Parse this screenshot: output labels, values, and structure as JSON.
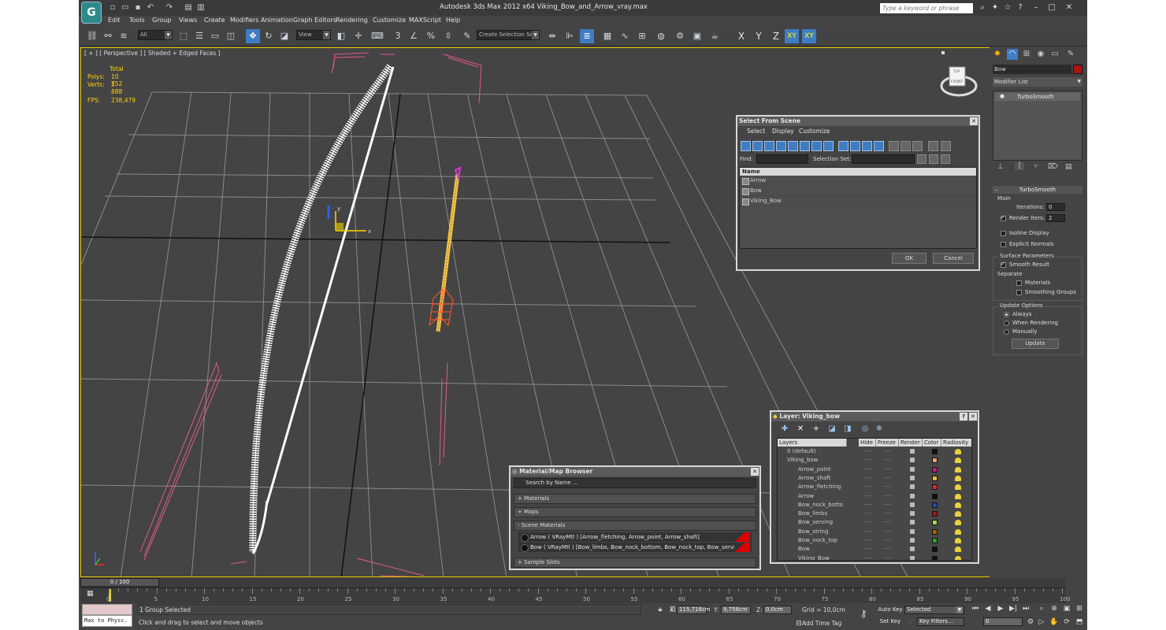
{
  "app": {
    "title": "Autodesk 3ds Max  2012 x64      Viking_Bow_and_Arrow_vray.max",
    "search_placeholder": "Type a keyword or phrase"
  },
  "menu": [
    "Edit",
    "Tools",
    "Group",
    "Views",
    "Create",
    "Modifiers",
    "Animation",
    "Graph Editors",
    "Rendering",
    "Customize",
    "MAXScript",
    "Help"
  ],
  "toolbar": {
    "filter_value": "All",
    "ref_coord_value": "View",
    "selection_set_value": "Create Selection Se",
    "snap_label": "3",
    "axes": [
      "X",
      "Y",
      "Z",
      "XY",
      "XY"
    ]
  },
  "viewport": {
    "label": "[ + ] [ Perspective ] [ Shaded + Edged Faces ]",
    "stats": {
      "header": "Total",
      "polys_label": "Polys:",
      "polys_value": "10 752",
      "verts_label": "Verts:",
      "verts_value": "5 888",
      "fps_label": "FPS:",
      "fps_value": "238,479"
    },
    "gizmo_x": "x",
    "gizmo_y": "y",
    "viewcube_top": "TOP",
    "viewcube_front": "FRONT",
    "colors": {
      "bow": "#ffffff",
      "arrow_shaft": "#f0c24a",
      "fletching": "#ff5a2a",
      "point": "#d63cd6",
      "bbox": "#e05a8a",
      "grid": "#8a8a8a"
    }
  },
  "select_from_scene": {
    "title": "Select From Scene",
    "menu": [
      "Select",
      "Display",
      "Customize"
    ],
    "find_label": "Find:",
    "selection_set_label": "Selection Set:",
    "column_name": "Name",
    "items": [
      "Arrow",
      "Bow",
      "Viking_Bow"
    ],
    "ok": "OK",
    "cancel": "Cancel"
  },
  "material_browser": {
    "title": "Material/Map Browser",
    "search": "Search by Name ...",
    "sections": {
      "materials": "+ Materials",
      "maps": "+ Maps",
      "scene": "- Scene Materials",
      "sample": "+ Sample Slots"
    },
    "scene_materials": [
      "Arrow  ( VRayMtl )  [Arrow_fletching, Arrow_point, Arrow_shaft]",
      "Bow  ( VRayMtl )  [Bow_limbs, Bow_nock_bottom, Bow_nock_top, Bow_serving,..."
    ]
  },
  "layer_manager": {
    "title": "Layer: Viking_bow",
    "columns": [
      "Layers",
      "Hide",
      "Freeze",
      "Render",
      "Color",
      "Radiosity"
    ],
    "rows": [
      {
        "name": "0 (default)",
        "indent": 1,
        "color": "#111111"
      },
      {
        "name": "Viking_bow",
        "indent": 0,
        "color": "#e6a07a"
      },
      {
        "name": "Arrow_point",
        "indent": 2,
        "color": "#c0208a"
      },
      {
        "name": "Arrow_shaft",
        "indent": 2,
        "color": "#e8b83a"
      },
      {
        "name": "Arrow_fletching",
        "indent": 2,
        "color": "#d03030"
      },
      {
        "name": "Arrow",
        "indent": 2,
        "color": "#111111"
      },
      {
        "name": "Bow_nock_botto",
        "indent": 2,
        "color": "#1c4fb0"
      },
      {
        "name": "Bow_limbs",
        "indent": 2,
        "color": "#a01818"
      },
      {
        "name": "Bow_serving",
        "indent": 2,
        "color": "#a8d84a"
      },
      {
        "name": "Bow_string",
        "indent": 2,
        "color": "#a06010"
      },
      {
        "name": "Bow_nock_top",
        "indent": 2,
        "color": "#2aa02a"
      },
      {
        "name": "Bow",
        "indent": 2,
        "color": "#111111"
      },
      {
        "name": "Viking_Bow",
        "indent": 2,
        "color": "#111111"
      }
    ]
  },
  "command_panel": {
    "object_name": "Bow",
    "modifier_list": "Modifier List",
    "stack_item": "TurboSmooth",
    "rollout_title": "TurboSmooth",
    "main_label": "Main",
    "iterations_label": "Iterations:",
    "iterations_value": "0",
    "render_iters_label": "Render Iters:",
    "render_iters_value": "2",
    "isoline": "Isoline Display",
    "explicit_normals": "Explicit Normals",
    "surface_params": "Surface Parameters",
    "smooth_result": "Smooth Result",
    "separate": "Separate",
    "materials": "Materials",
    "smoothing_groups": "Smoothing Groups",
    "update_options": "Update Options",
    "always": "Always",
    "when_rendering": "When Rendering",
    "manually": "Manually",
    "update_btn": "Update"
  },
  "timeline": {
    "slider": "0 / 100",
    "ticks": [
      "0",
      "5",
      "10",
      "15",
      "20",
      "25",
      "30",
      "35",
      "40",
      "45",
      "50",
      "55",
      "60",
      "65",
      "70",
      "75",
      "80",
      "85",
      "90",
      "95",
      "100"
    ]
  },
  "status": {
    "maxscript": "Max to Physc.",
    "selected": "1 Group Selected",
    "prompt": "Click and drag to select and move objects",
    "x_label": "X:",
    "x_value": "115,716cm",
    "y_label": "Y:",
    "y_value": "9,756cm",
    "z_label": "Z:",
    "z_value": "0,0cm",
    "grid": "Grid = 10,0cm",
    "add_time_tag": "Add Time Tag",
    "auto_key": "Auto Key",
    "set_key": "Set Key",
    "key_mode": "Selected",
    "key_filters": "Key Filters...",
    "frame": "0"
  }
}
